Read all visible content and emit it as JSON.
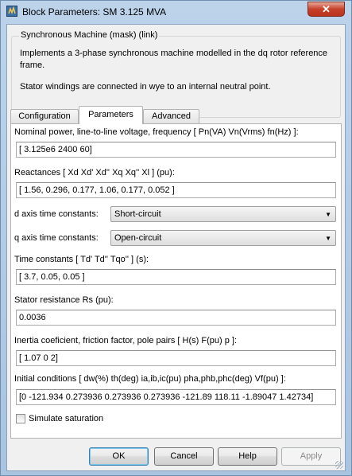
{
  "window": {
    "title": "Block Parameters: SM 3.125 MVA",
    "close_glyph": "✕"
  },
  "mask": {
    "group_title": "Synchronous Machine (mask) (link)",
    "description_line1": "Implements a 3-phase synchronous machine modelled in the dq rotor reference",
    "description_line2": "frame.",
    "description_line3": "Stator windings are connected in wye to an internal neutral point."
  },
  "tabs": [
    {
      "label": "Configuration",
      "active": false
    },
    {
      "label": "Parameters",
      "active": true
    },
    {
      "label": "Advanced",
      "active": false
    }
  ],
  "params": {
    "nominal_label": "Nominal power, line-to-line voltage, frequency [ Pn(VA)  Vn(Vrms)  fn(Hz) ]:",
    "nominal_value": "[ 3.125e6  2400  60]",
    "reactances_label": "Reactances [ Xd  Xd'  Xd''  Xq  Xq''  Xl ] (pu):",
    "reactances_value": "[ 1.56, 0.296, 0.177, 1.06, 0.177, 0.052 ]",
    "d_axis_label": "d axis time constants:",
    "d_axis_value": "Short-circuit",
    "q_axis_label": "q axis time constants:",
    "q_axis_value": "Open-circuit",
    "time_constants_label": "Time constants [ Td'  Td''  Tqo'' ] (s):",
    "time_constants_value": "[ 3.7, 0.05, 0.05 ]",
    "stator_label": "Stator resistance Rs (pu):",
    "stator_value": "0.0036",
    "inertia_label": "Inertia coeficient, friction factor, pole pairs [ H(s)  F(pu)  p ]:",
    "inertia_value": "[ 1.07  0  2]",
    "initial_label": "Initial conditions [ dw(%)  th(deg)  ia,ib,ic(pu)  pha,phb,phc(deg)  Vf(pu) ]:",
    "initial_value": "[0 -121.934 0.273936 0.273936 0.273936 -121.89 118.11 -1.89047 1.42734]",
    "simulate_saturation_label": "Simulate saturation",
    "simulate_saturation_checked": false
  },
  "buttons": {
    "ok": "OK",
    "cancel": "Cancel",
    "help": "Help",
    "apply": "Apply"
  }
}
